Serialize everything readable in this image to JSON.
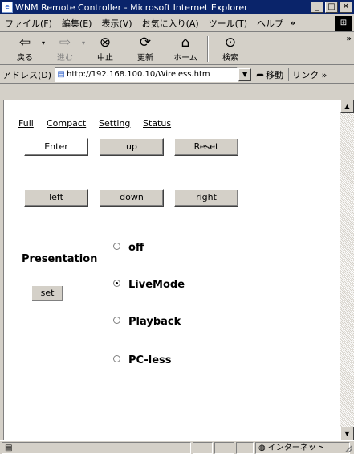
{
  "window": {
    "title": "WNM Remote Controller - Microsoft Internet Explorer",
    "minimize_glyph": "_",
    "maximize_glyph": "□",
    "close_glyph": "✕"
  },
  "menubar": {
    "items": [
      "ファイル(F)",
      "編集(E)",
      "表示(V)",
      "お気に入り(A)",
      "ツール(T)",
      "ヘルプ"
    ],
    "more": "»"
  },
  "toolbar": {
    "back": {
      "label": "戻る",
      "icon": "back-arrow-icon"
    },
    "forward": {
      "label": "進む",
      "icon": "forward-arrow-icon"
    },
    "stop": {
      "label": "中止",
      "icon": "stop-icon"
    },
    "refresh": {
      "label": "更新",
      "icon": "refresh-icon"
    },
    "home": {
      "label": "ホーム",
      "icon": "home-icon"
    },
    "search": {
      "label": "検索",
      "icon": "search-icon"
    },
    "more": "»"
  },
  "addressbar": {
    "label": "アドレス(D)",
    "url": "http://192.168.100.10/Wireless.htm",
    "go_label": "移動",
    "links_label": "リンク",
    "links_more": "»"
  },
  "page": {
    "nav_links": [
      "Full",
      "Compact",
      "Setting",
      "Status"
    ],
    "buttons_row1": [
      "Enter",
      "up",
      "Reset"
    ],
    "buttons_row2": [
      "left",
      "down",
      "right"
    ],
    "presentation_label": "Presentation",
    "set_label": "set",
    "radio_options": [
      {
        "label": "off",
        "checked": false
      },
      {
        "label": "LiveMode",
        "checked": true
      },
      {
        "label": "Playback",
        "checked": false
      },
      {
        "label": "PC-less",
        "checked": false
      }
    ]
  },
  "statusbar": {
    "zone": "インターネット"
  },
  "colors": {
    "title_bar": "#0a246a",
    "chrome": "#d4d0c8"
  }
}
